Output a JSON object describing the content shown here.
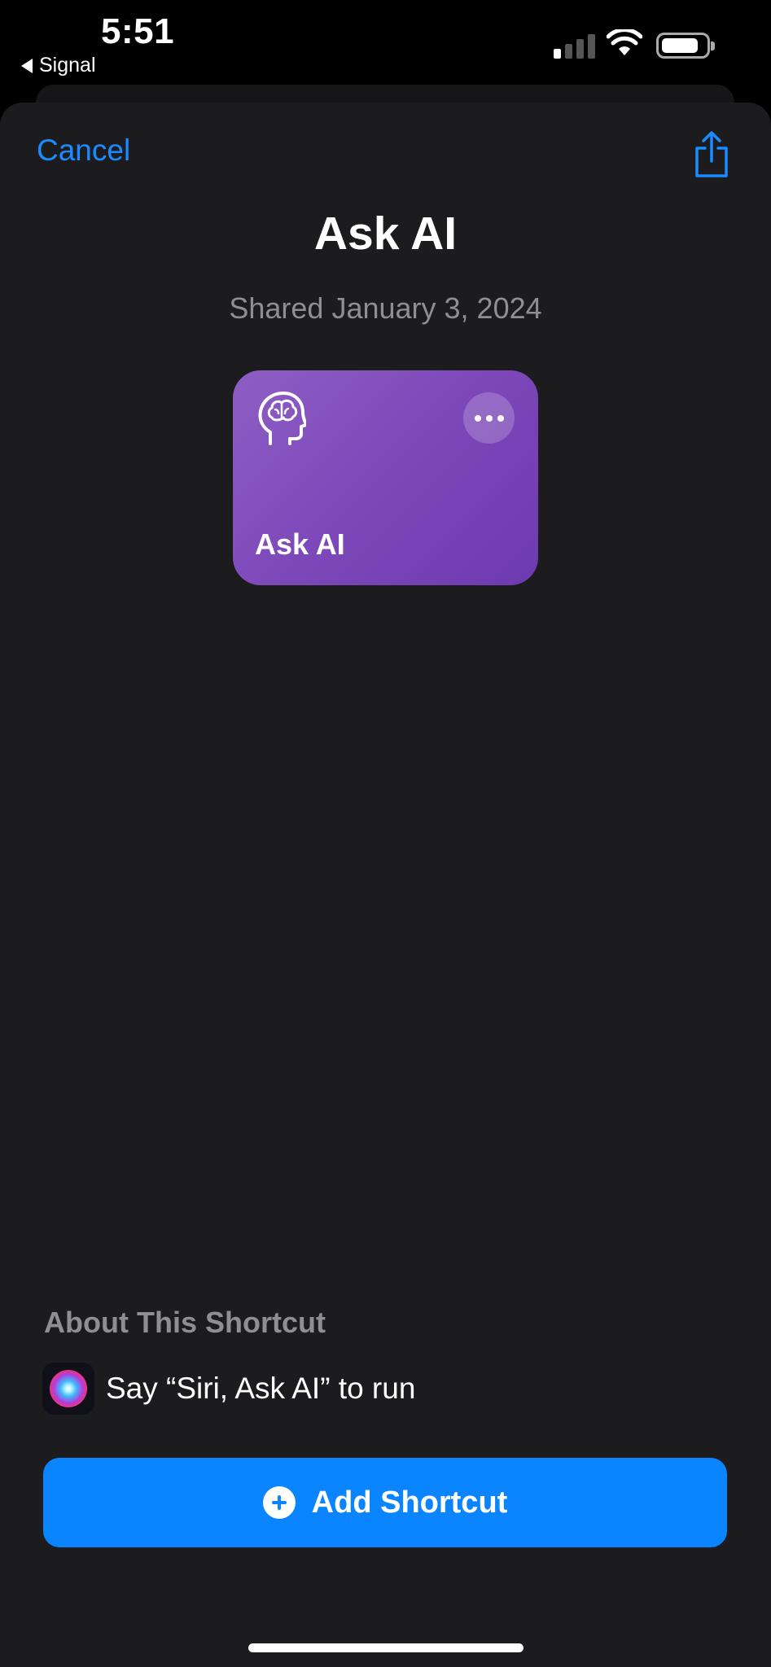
{
  "status_bar": {
    "time": "5:51",
    "back_app": "Signal",
    "icons": [
      "cellular-signal-icon",
      "wifi-icon",
      "battery-icon"
    ],
    "battery_level": 0.85,
    "signal_bars": 1
  },
  "nav": {
    "cancel_label": "Cancel",
    "share_icon": "share-icon"
  },
  "header": {
    "title": "Ask AI",
    "shared_date": "Shared January 3, 2024"
  },
  "shortcut_card": {
    "name": "Ask AI",
    "icon": "head-brain-icon",
    "more_icon": "ellipsis-icon",
    "colors": {
      "gradient_start": "#8e5ec4",
      "gradient_end": "#6e3ab0"
    }
  },
  "about": {
    "heading": "About This Shortcut",
    "siri_phrase": "Say “Siri, Ask AI” to run",
    "icon": "siri-icon"
  },
  "primary_action": {
    "label": "Add Shortcut",
    "icon": "plus-circle-icon"
  },
  "colors": {
    "accent": "#0a84ff",
    "sheet_background": "#1c1c1e",
    "secondary_text": "#8e8e93"
  }
}
